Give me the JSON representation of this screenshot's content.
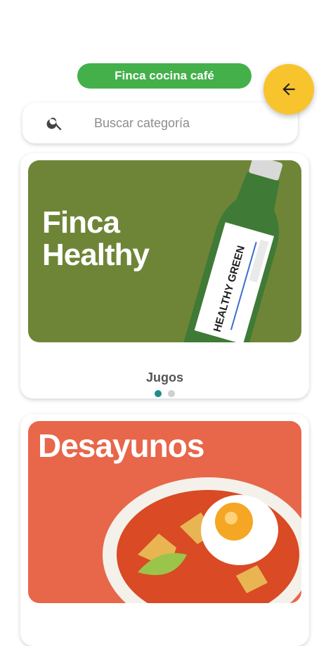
{
  "header": {
    "title": "Finca cocina café"
  },
  "back_button": {
    "icon": "arrow-left-icon"
  },
  "search": {
    "placeholder": "Buscar categoría",
    "icon": "search-icon"
  },
  "categories": [
    {
      "banner_text": "Finca\nHealthy",
      "label": "Jugos",
      "banner_color": "#6e8537",
      "bottle_text": "HEALTHY GREEN"
    },
    {
      "banner_text": "Desayunos",
      "label": "",
      "banner_color": "#e8664a"
    }
  ],
  "carousel": {
    "total": 2,
    "active": 0
  },
  "colors": {
    "accent_green": "#43b04a",
    "fab_yellow": "#f8c42d",
    "dot_active": "#1f8c8c"
  }
}
